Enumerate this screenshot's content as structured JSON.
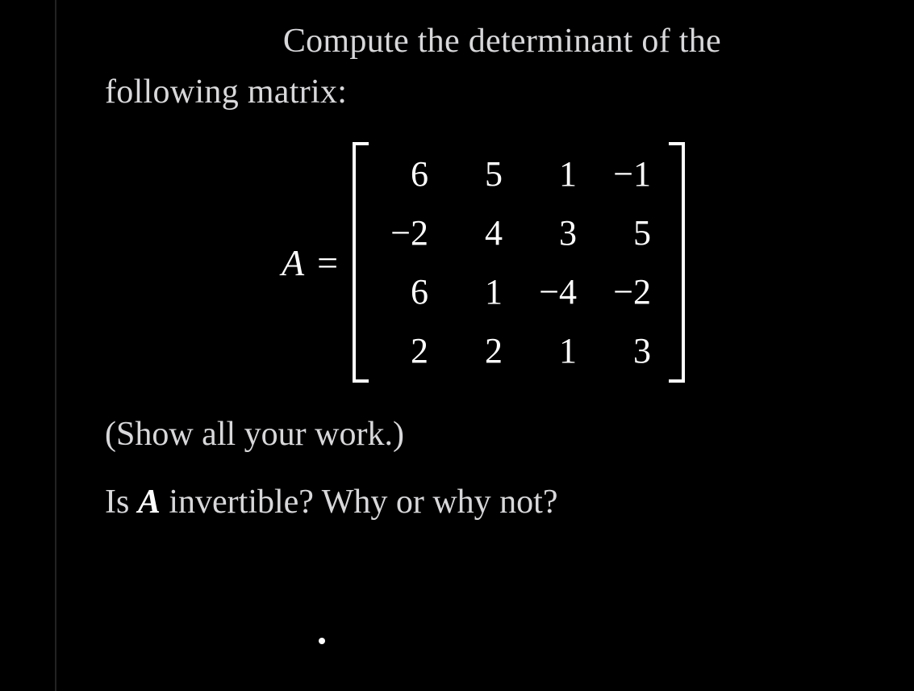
{
  "question": {
    "line1_part1": "Compute the determinant of the",
    "line2": "following matrix:"
  },
  "matrix": {
    "label": "A",
    "equals": "=",
    "rows": [
      [
        "6",
        "5",
        "1",
        "−1"
      ],
      [
        "−2",
        "4",
        "3",
        "5"
      ],
      [
        "6",
        "1",
        "−4",
        "−2"
      ],
      [
        "2",
        "2",
        "1",
        "3"
      ]
    ]
  },
  "show_work": "(Show all your work.)",
  "q2": {
    "prefix": "Is ",
    "var": "A",
    "suffix": " invertible? Why or why not?"
  }
}
